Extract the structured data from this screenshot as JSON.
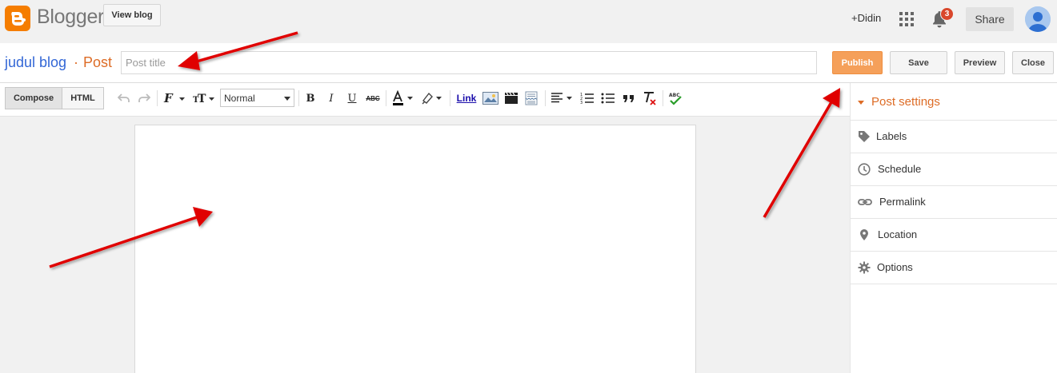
{
  "app": {
    "name": "Blogger",
    "view_blog_label": "View blog"
  },
  "header": {
    "user_label": "+Didin",
    "notification_count": "3",
    "share_label": "Share"
  },
  "post": {
    "blog_name": "judul blog",
    "separator": "·",
    "post_label": "Post",
    "title_placeholder": "Post title"
  },
  "actions": {
    "publish": "Publish",
    "save": "Save",
    "preview": "Preview",
    "close": "Close"
  },
  "toolbar": {
    "compose": "Compose",
    "html": "HTML",
    "format_value": "Normal",
    "link_label": "Link",
    "bold": "B",
    "italic": "I",
    "underline": "U",
    "strike": "ABC"
  },
  "sidebar": {
    "title": "Post settings",
    "items": [
      {
        "label": "Labels",
        "icon": "tag-icon"
      },
      {
        "label": "Schedule",
        "icon": "clock-icon"
      },
      {
        "label": "Permalink",
        "icon": "link-icon"
      },
      {
        "label": "Location",
        "icon": "pin-icon"
      },
      {
        "label": "Options",
        "icon": "gear-icon"
      }
    ]
  },
  "colors": {
    "brand": "#f57d00",
    "accent": "#dd6c26",
    "link": "#3367d6",
    "publish": "#f5a05a",
    "annotation_arrow": "#e00000"
  }
}
